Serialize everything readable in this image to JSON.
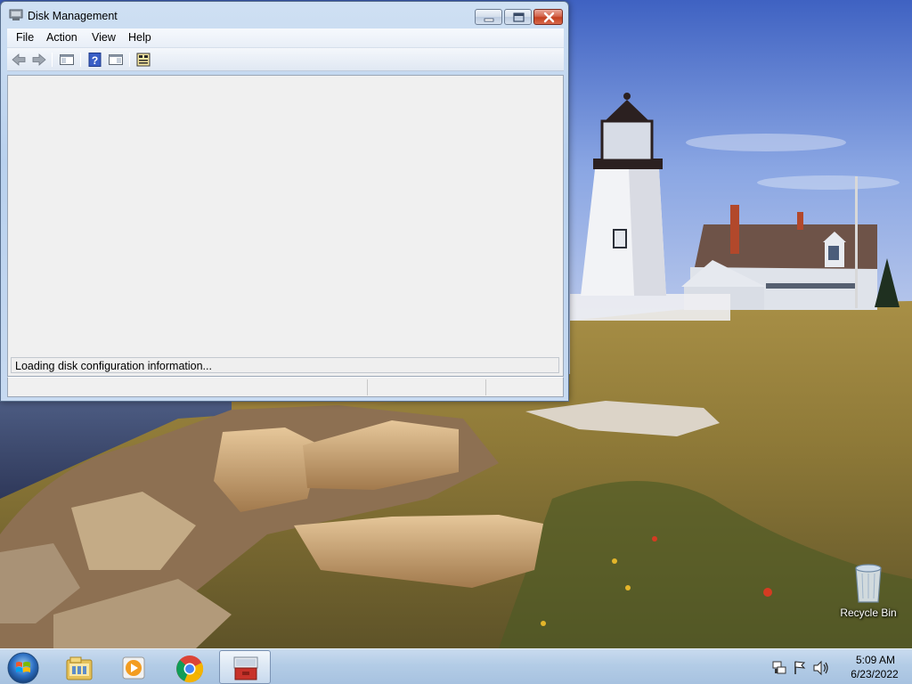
{
  "window": {
    "title": "Disk Management",
    "menu": [
      "File",
      "Action",
      "View",
      "Help"
    ],
    "toolbar_icons": [
      "back-arrow-icon",
      "forward-arrow-icon",
      "show-hide-console-tree-icon",
      "help-icon",
      "show-hide-action-pane-icon",
      "disk-properties-icon"
    ],
    "loading_text": "Loading disk configuration information...",
    "controls": [
      "minimize",
      "maximize",
      "close"
    ]
  },
  "desktop": {
    "icons": [
      {
        "label": "Recycle Bin",
        "icon": "recycle-bin-icon"
      }
    ],
    "wallpaper": "lighthouse-coast"
  },
  "taskbar": {
    "start_icon": "windows-start-orb",
    "apps": [
      {
        "name": "windows-explorer",
        "icon": "folder-library-icon",
        "active": false
      },
      {
        "name": "media-player",
        "icon": "media-player-icon",
        "active": false
      },
      {
        "name": "chrome",
        "icon": "chrome-icon",
        "active": false
      },
      {
        "name": "computer-management",
        "icon": "toolbox-icon",
        "active": true
      }
    ],
    "tray_icons": [
      "network-icon",
      "action-center-flag-icon",
      "volume-icon"
    ],
    "clock": {
      "time": "5:09 AM",
      "date": "6/23/2022"
    }
  },
  "colors": {
    "title_bar": "#c4d8f0",
    "close_button": "#c8452a",
    "taskbar": "#b3cce6"
  }
}
